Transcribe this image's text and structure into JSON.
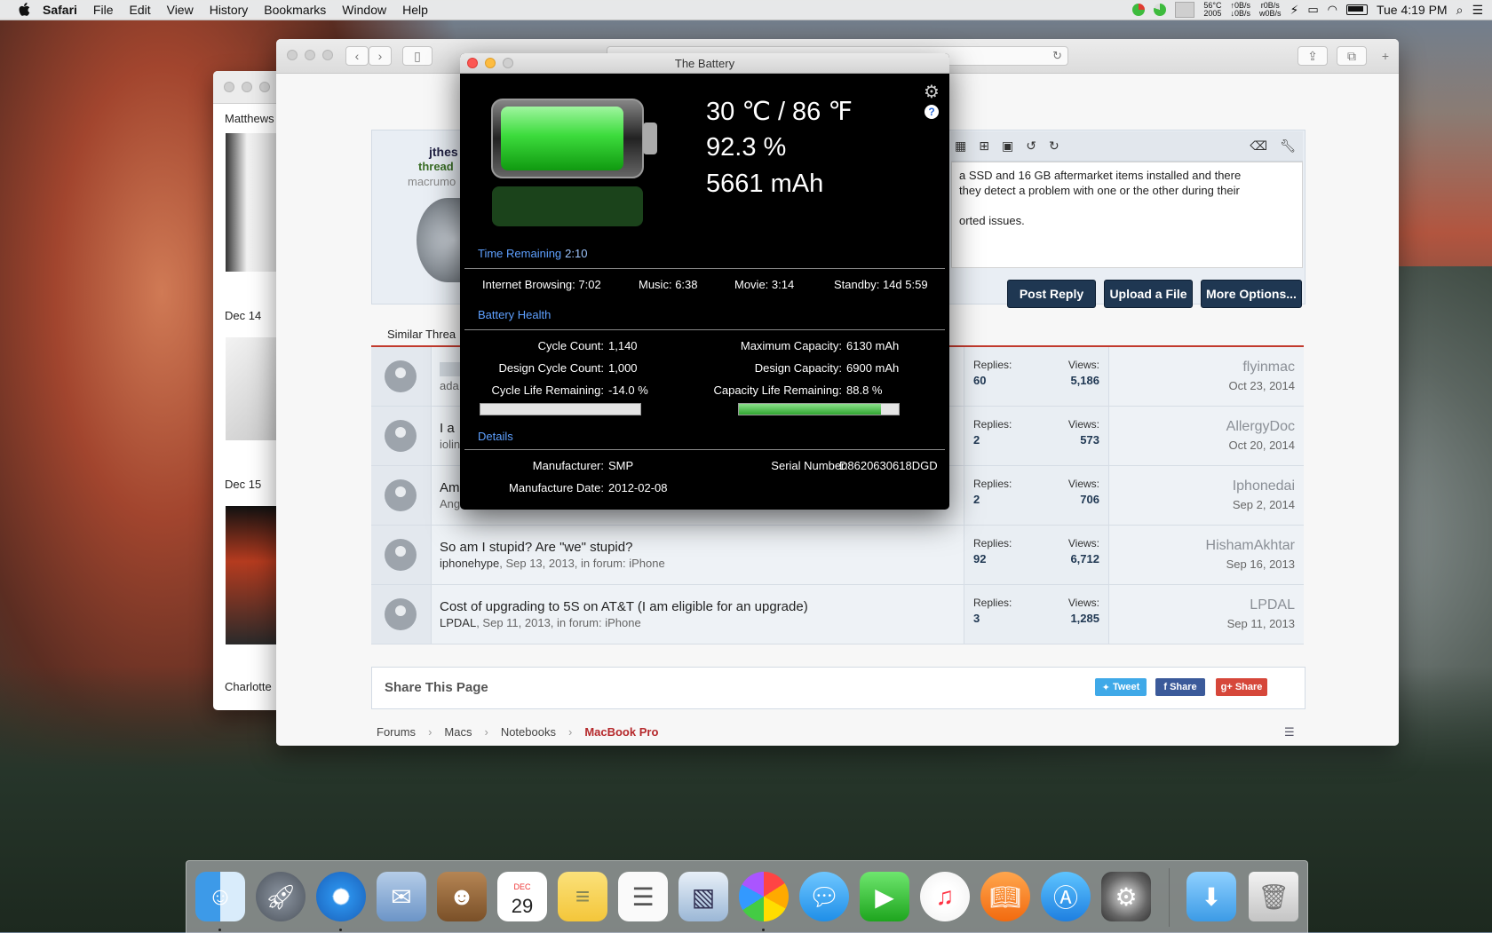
{
  "menubar": {
    "app": "Safari",
    "items": [
      "File",
      "Edit",
      "View",
      "History",
      "Bookmarks",
      "Window",
      "Help"
    ],
    "temp": "56°C",
    "temp_sub": "2005",
    "net_up": "↑0B/s",
    "net_down": "↓0B/s",
    "disk_r": "r0B/s",
    "disk_w": "w0B/s",
    "clock": "Tue 4:19 PM"
  },
  "back_window": {
    "name": "Matthews",
    "date1": "Dec 14",
    "date2": "Dec 15",
    "name2": "Charlotte"
  },
  "forum": {
    "username": "jthes",
    "user_title": "thread",
    "user_site": "macrumo",
    "editor_text_1": "a SSD and 16 GB aftermarket items installed and there",
    "editor_text_2": "they detect a problem with one or the other during their",
    "editor_text_3": "orted issues.",
    "post_reply": "Post Reply",
    "upload": "Upload a File",
    "more_options": "More Options...",
    "similar_tab": "Similar Threa",
    "rows": [
      {
        "title": "",
        "meta": "ada",
        "replies": "60",
        "views": "5,186",
        "last_user": "flyinmac",
        "last_date": "Oct 23, 2014"
      },
      {
        "title": "I a",
        "meta": "iolin",
        "replies": "2",
        "views": "573",
        "last_user": "AllergyDoc",
        "last_date": "Oct 20, 2014"
      },
      {
        "title": "Am",
        "meta": "Ang",
        "replies": "2",
        "views": "706",
        "last_user": "Iphonedai",
        "last_date": "Sep 2, 2014"
      },
      {
        "title": "So am I stupid? Are \"we\" stupid?",
        "meta_user": "iphonehype",
        "meta": ", Sep 13, 2013, in forum: iPhone",
        "replies": "92",
        "views": "6,712",
        "last_user": "HishamAkhtar",
        "last_date": "Sep 16, 2013"
      },
      {
        "title": "Cost of upgrading to 5S on AT&T (I am eligible for an upgrade)",
        "meta_user": "LPDAL",
        "meta": ", Sep 11, 2013, in forum: iPhone",
        "replies": "3",
        "views": "1,285",
        "last_user": "LPDAL",
        "last_date": "Sep 11, 2013"
      }
    ],
    "replies_label": "Replies:",
    "views_label": "Views:",
    "share_title": "Share This Page",
    "tweet": "Tweet",
    "fb_share": "Share",
    "gplus_share": "Share",
    "crumbs": [
      "Forums",
      "Macs",
      "Notebooks"
    ],
    "crumb_current": "MacBook Pro"
  },
  "battery": {
    "window_title": "The Battery",
    "temperature": "30 ℃ / 86 ℉",
    "charge": "92.3 %",
    "capacity_now": "5661 mAh",
    "charge_fraction": 0.923,
    "time_remaining_label": "Time Remaining",
    "time_remaining": "2:10",
    "internet_label": "Internet Browsing:",
    "internet": "7:02",
    "music_label": "Music:",
    "music": "6:38",
    "movie_label": "Movie:",
    "movie": "3:14",
    "standby_label": "Standby:",
    "standby": "14d 5:59",
    "health_label": "Battery Health",
    "cycle_count_label": "Cycle Count:",
    "cycle_count": "1,140",
    "design_cycle_label": "Design Cycle Count:",
    "design_cycle": "1,000",
    "cycle_life_label": "Cycle Life Remaining:",
    "cycle_life": "-14.0 %",
    "cycle_life_fraction": 0.0,
    "max_cap_label": "Maximum Capacity:",
    "max_cap": "6130 mAh",
    "design_cap_label": "Design Capacity:",
    "design_cap": "6900 mAh",
    "cap_life_label": "Capacity Life Remaining:",
    "cap_life": "88.8 %",
    "cap_life_fraction": 0.888,
    "details_label": "Details",
    "manufacturer_label": "Manufacturer:",
    "manufacturer": "SMP",
    "serial_label": "Serial Number:",
    "serial": "D8620630618DGD",
    "mfg_date_label": "Manufacture Date:",
    "mfg_date": "2012-02-08"
  },
  "dock": {
    "calendar_month": "DEC",
    "calendar_day": "29"
  }
}
